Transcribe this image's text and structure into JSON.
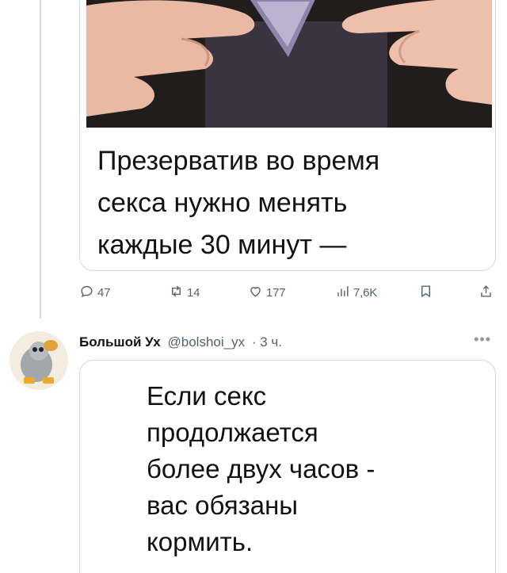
{
  "tweet1": {
    "card_text_lines": [
      "Презерватив во время",
      "секса нужно менять",
      "каждые 30 минут —"
    ],
    "actions": {
      "replies": "47",
      "retweets": "14",
      "likes": "177",
      "views": "7,6K"
    }
  },
  "tweet2": {
    "author": "Большой Ух",
    "handle": "@bolshoi_yx",
    "time": "· 3 ч.",
    "more": "•••",
    "card_text_lines": [
      "Если секс",
      "продолжается",
      "более двух часов -",
      "вас обязаны",
      "кормить."
    ]
  },
  "colors": {
    "muted": "#536471",
    "border": "#cfd9de",
    "text": "#0f1419"
  },
  "icons": [
    "reply-icon",
    "retweet-icon",
    "like-icon",
    "views-icon",
    "bookmark-icon",
    "share-icon",
    "more-icon"
  ]
}
